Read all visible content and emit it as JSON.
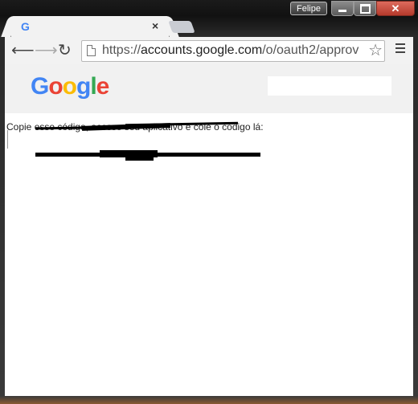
{
  "window": {
    "user_name": "Felipe"
  },
  "tab": {
    "favicon_letter": "G",
    "title": "",
    "close_glyph": "×"
  },
  "toolbar": {
    "url_scheme": "https://",
    "url_host": "accounts.google.com",
    "url_path": "/o/oauth2/approv"
  },
  "page": {
    "logo_letters": [
      {
        "ch": "G",
        "color": "#4285F4"
      },
      {
        "ch": "o",
        "color": "#EA4335"
      },
      {
        "ch": "o",
        "color": "#FBBC05"
      },
      {
        "ch": "g",
        "color": "#4285F4"
      },
      {
        "ch": "l",
        "color": "#34A853"
      },
      {
        "ch": "e",
        "color": "#EA4335"
      }
    ],
    "instruction": "Copie esse código, acesse seu aplicativo e cole o código lá:"
  }
}
